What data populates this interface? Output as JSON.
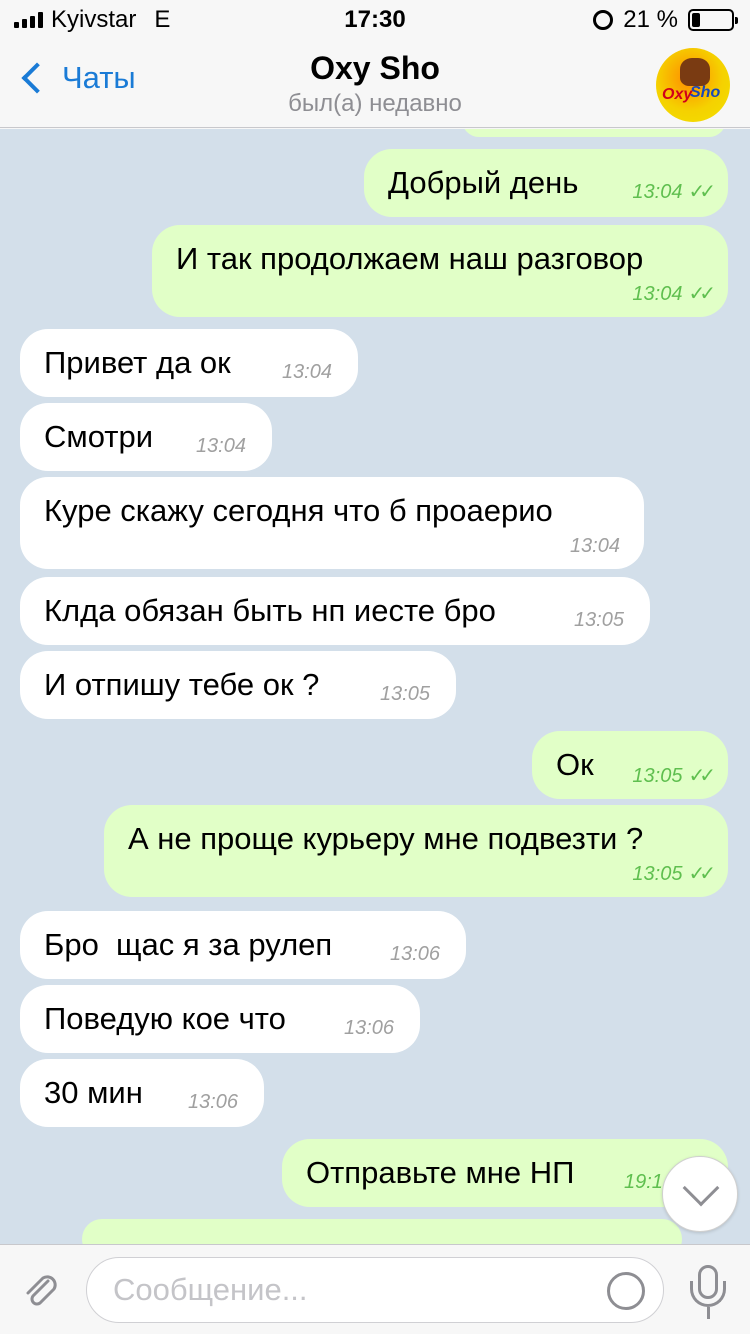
{
  "status": {
    "carrier": "Kyivstar",
    "network": "E",
    "time": "17:30",
    "battery": "21 %",
    "battery_level": 0.21
  },
  "header": {
    "back_label": "Чаты",
    "contact_name": "Oxy Sho",
    "last_seen": "был(а) недавно",
    "avatar_text_1": "Oxy",
    "avatar_text_2": "Sho"
  },
  "messages": [
    {
      "dir": "out",
      "text": "Добрый день",
      "time": "13:04"
    },
    {
      "dir": "out",
      "text": "И так продолжаем наш разговор",
      "time": "13:04"
    },
    {
      "dir": "in",
      "text": "Привет да ок",
      "time": "13:04"
    },
    {
      "dir": "in",
      "text": "Смотри",
      "time": "13:04"
    },
    {
      "dir": "in",
      "text": "Куре скажу сегодня что б проаерио",
      "time": "13:04"
    },
    {
      "dir": "in",
      "text": "Клда обязан быть нп иесте бро",
      "time": "13:05"
    },
    {
      "dir": "in",
      "text": "И отпишу тебе ок ?",
      "time": "13:05"
    },
    {
      "dir": "out",
      "text": "Ок",
      "time": "13:05"
    },
    {
      "dir": "out",
      "text": "А не проще курьеру мне подвезти ?",
      "time": "13:05"
    },
    {
      "dir": "in",
      "text": "Бро  щас я за рулеп",
      "time": "13:06"
    },
    {
      "dir": "in",
      "text": "Поведую кое что",
      "time": "13:06"
    },
    {
      "dir": "in",
      "text": "30 мин",
      "time": "13:06"
    },
    {
      "dir": "out",
      "text": "Отправьте мне НП",
      "time": "19:1"
    }
  ],
  "input": {
    "placeholder": "Сообщение..."
  },
  "colors": {
    "accent": "#1a7bd6",
    "chat_bg": "#d3dfea",
    "bubble_out": "#e1ffc7",
    "bubble_in": "#ffffff",
    "check_green": "#5fbf4f"
  },
  "icons": {
    "back": "chevron-left-icon",
    "attach": "paperclip-icon",
    "sticker": "sticker-icon",
    "mic": "microphone-icon",
    "scroll_down": "chevron-down-icon"
  }
}
